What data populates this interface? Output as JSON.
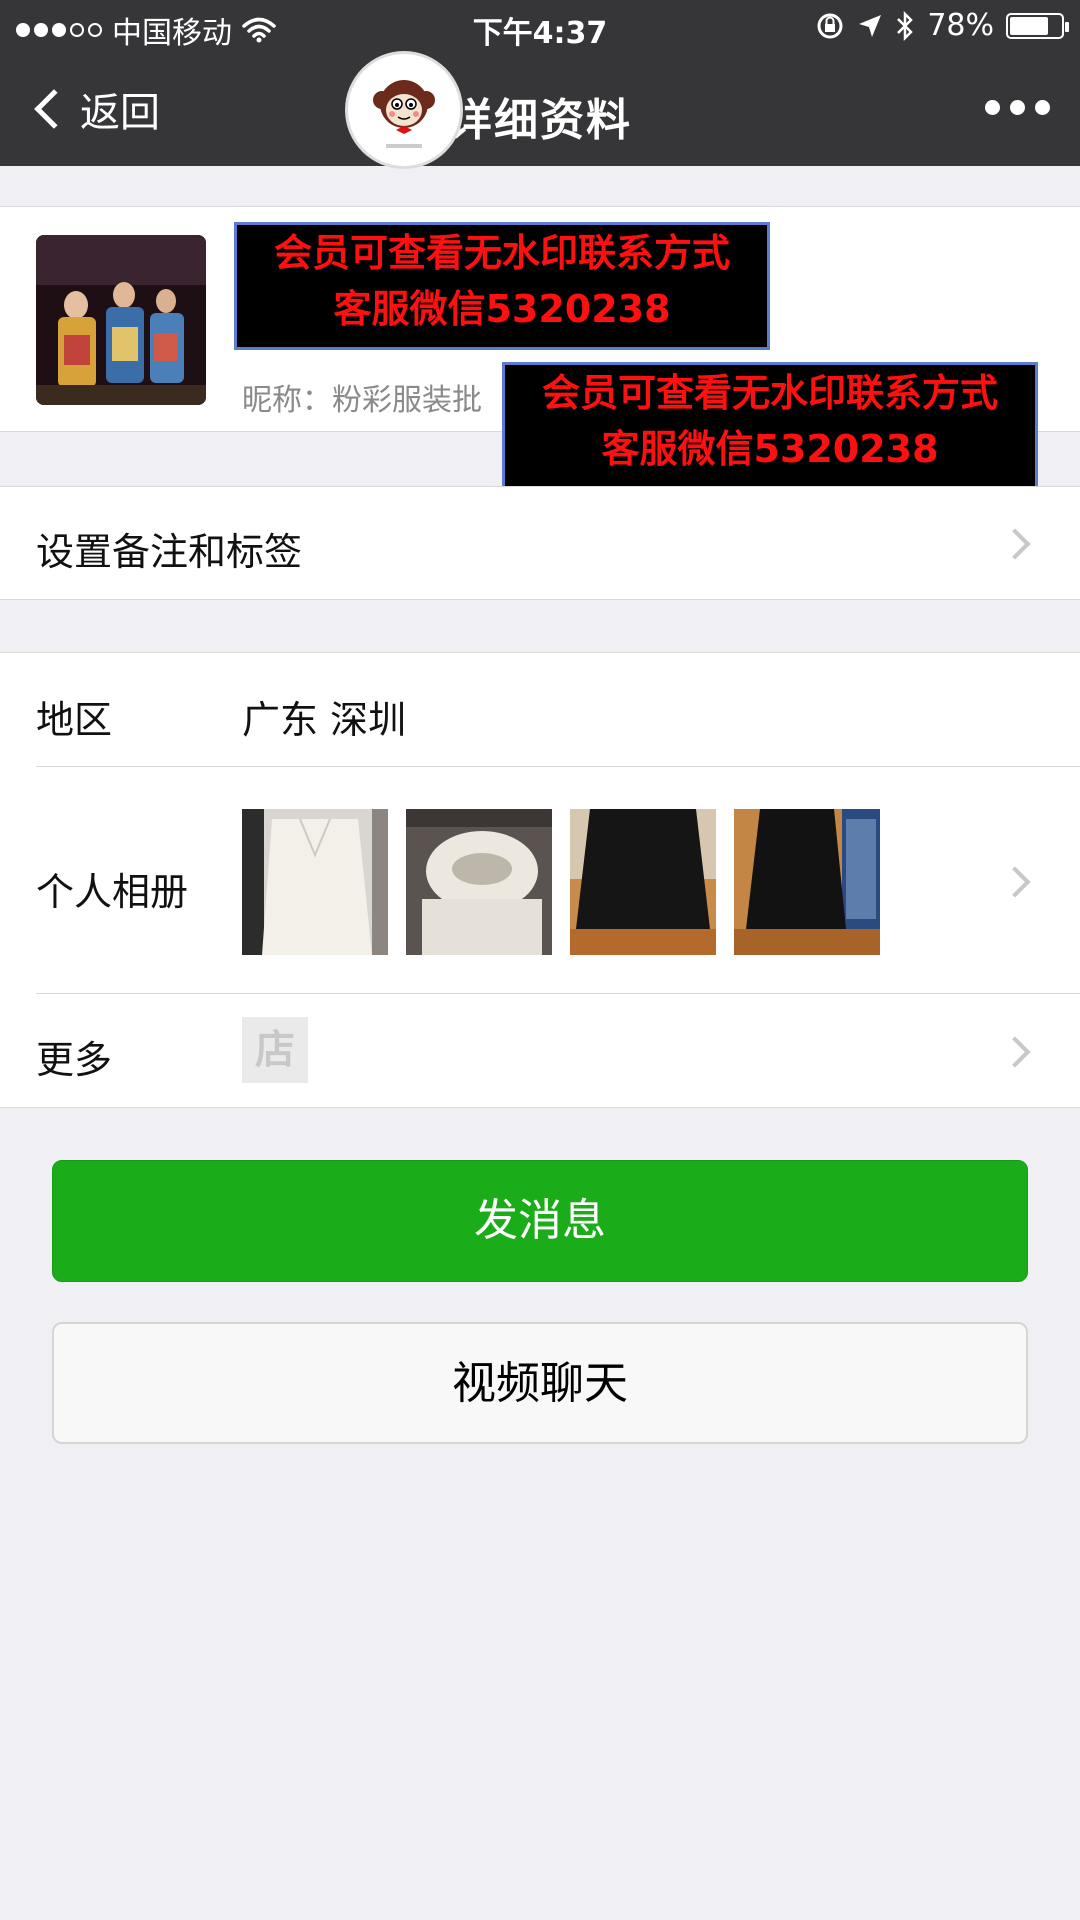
{
  "status_bar": {
    "carrier": "中国移动",
    "time": "下午4:37",
    "battery": "78%",
    "battery_level": 0.78,
    "icons": [
      "signal-dots-icon",
      "wifi-icon",
      "orientation-lock-icon",
      "location-arrow-icon",
      "bluetooth-icon",
      "battery-icon"
    ]
  },
  "navbar": {
    "back_label": "返回",
    "title": "详细资料",
    "more_icon": "more-dots-icon"
  },
  "profile": {
    "nickname": "昵称：粉彩服装批"
  },
  "watermark": {
    "line1": "会员可查看无水印联系方式",
    "line2": "客服微信5320238"
  },
  "remark_row": {
    "label": "设置备注和标签"
  },
  "region_row": {
    "label": "地区",
    "value": "广东 深圳"
  },
  "album_row": {
    "label": "个人相册",
    "photos": [
      "white-sweater-photo",
      "white-turtleneck-photo",
      "black-skirt-photo",
      "black-dress-photo"
    ]
  },
  "more_row": {
    "label": "更多",
    "shop_glyph": "店"
  },
  "buttons": {
    "send_message": "发消息",
    "video_chat": "视频聊天"
  },
  "colors": {
    "navbar_bg": "#363639",
    "primary_green": "#1aad19",
    "page_bg": "#efeff4",
    "watermark_red": "#ff1010"
  }
}
